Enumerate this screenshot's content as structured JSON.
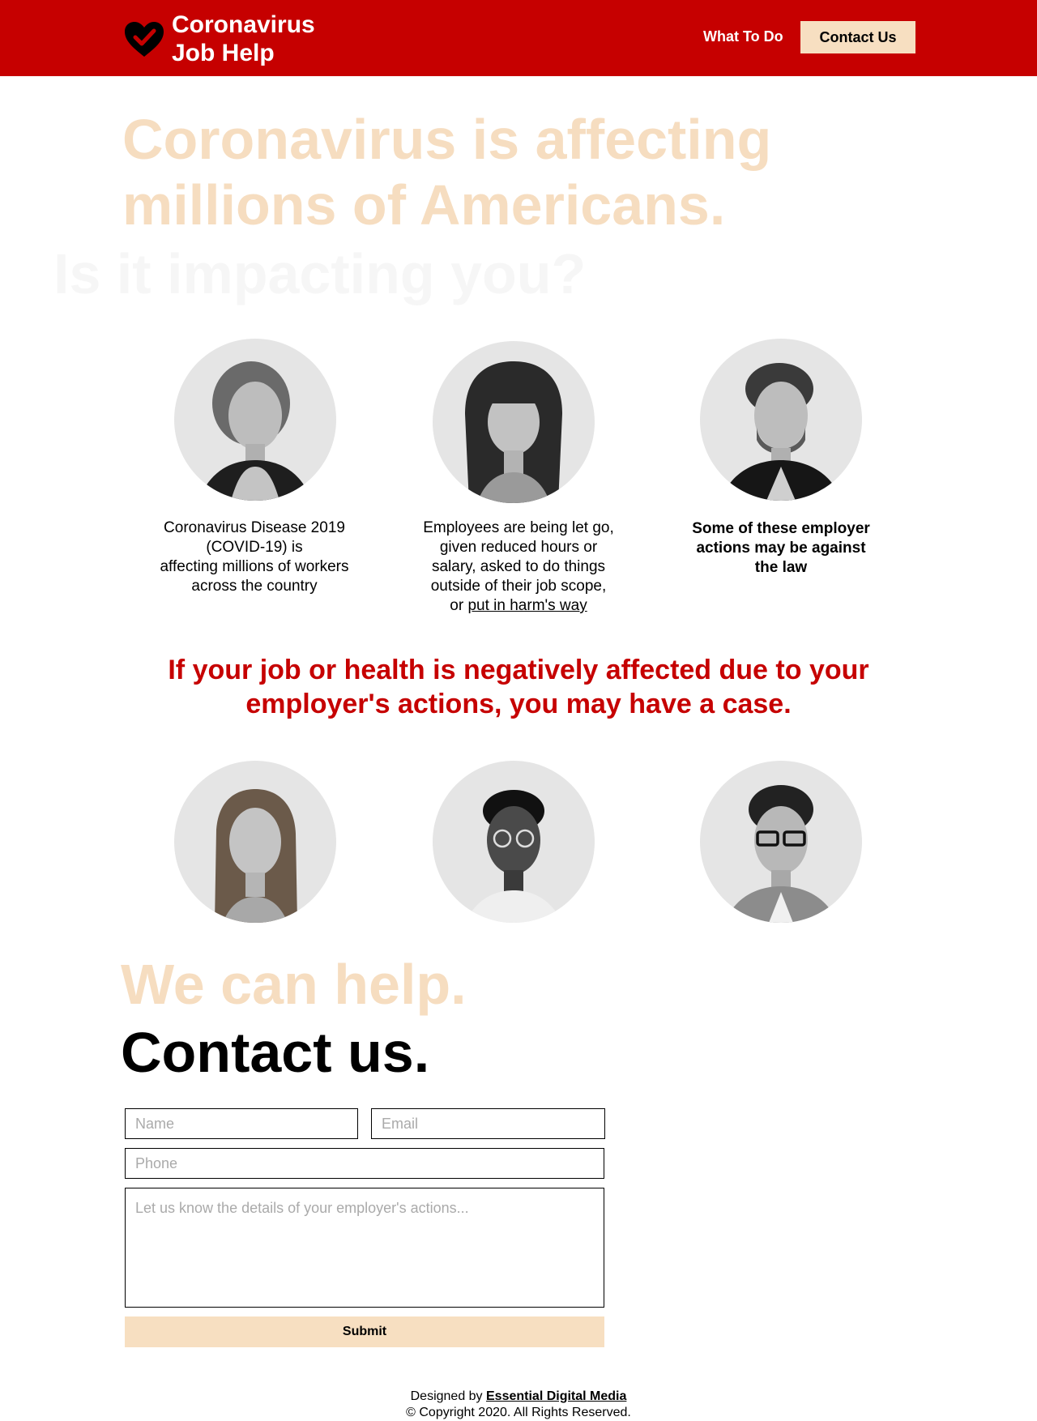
{
  "header": {
    "logo_icon": "heart-check-icon",
    "logo_line1": "Coronavirus",
    "logo_line2": "Job Help",
    "nav_what_to_do": "What To Do",
    "nav_contact": "Contact Us"
  },
  "hero": {
    "line1": "Coronavirus is affecting",
    "line2": "millions of Americans.",
    "line3": "Is it impacting you?"
  },
  "captions": {
    "c1_l1": "Coronavirus Disease 2019",
    "c1_l2": "(COVID-19) is",
    "c1_l3": "affecting millions of workers",
    "c1_l4": "across the country",
    "c2_l1": "Employees are being let go,",
    "c2_l2": "given reduced hours or",
    "c2_l3": "salary, asked to do things",
    "c2_l4": "outside of their job scope,",
    "c2_l5_prefix": "or ",
    "c2_l5_link": "put in harm's way",
    "c3_l1": "Some of these employer",
    "c3_l2": "actions may be against",
    "c3_l3": "the law"
  },
  "case_message": {
    "line1": "If your job or health is negatively affected due to your",
    "line2": "employer's actions, you may have a case."
  },
  "help_title": "We can help.",
  "contact_title": "Contact us.",
  "form": {
    "name_placeholder": "Name",
    "email_placeholder": "Email",
    "phone_placeholder": "Phone",
    "details_placeholder": "Let us know the details of your employer's actions...",
    "submit_label": "Submit"
  },
  "footer": {
    "designed_by_prefix": "Designed by ",
    "designer_link": "Essential Digital Media",
    "copyright": "© Copyright 2020.  All Rights Reserved."
  },
  "colors": {
    "brand_red": "#c60000",
    "accent_peach": "#f7dfc1",
    "hero_peach": "#f6ddc0"
  }
}
